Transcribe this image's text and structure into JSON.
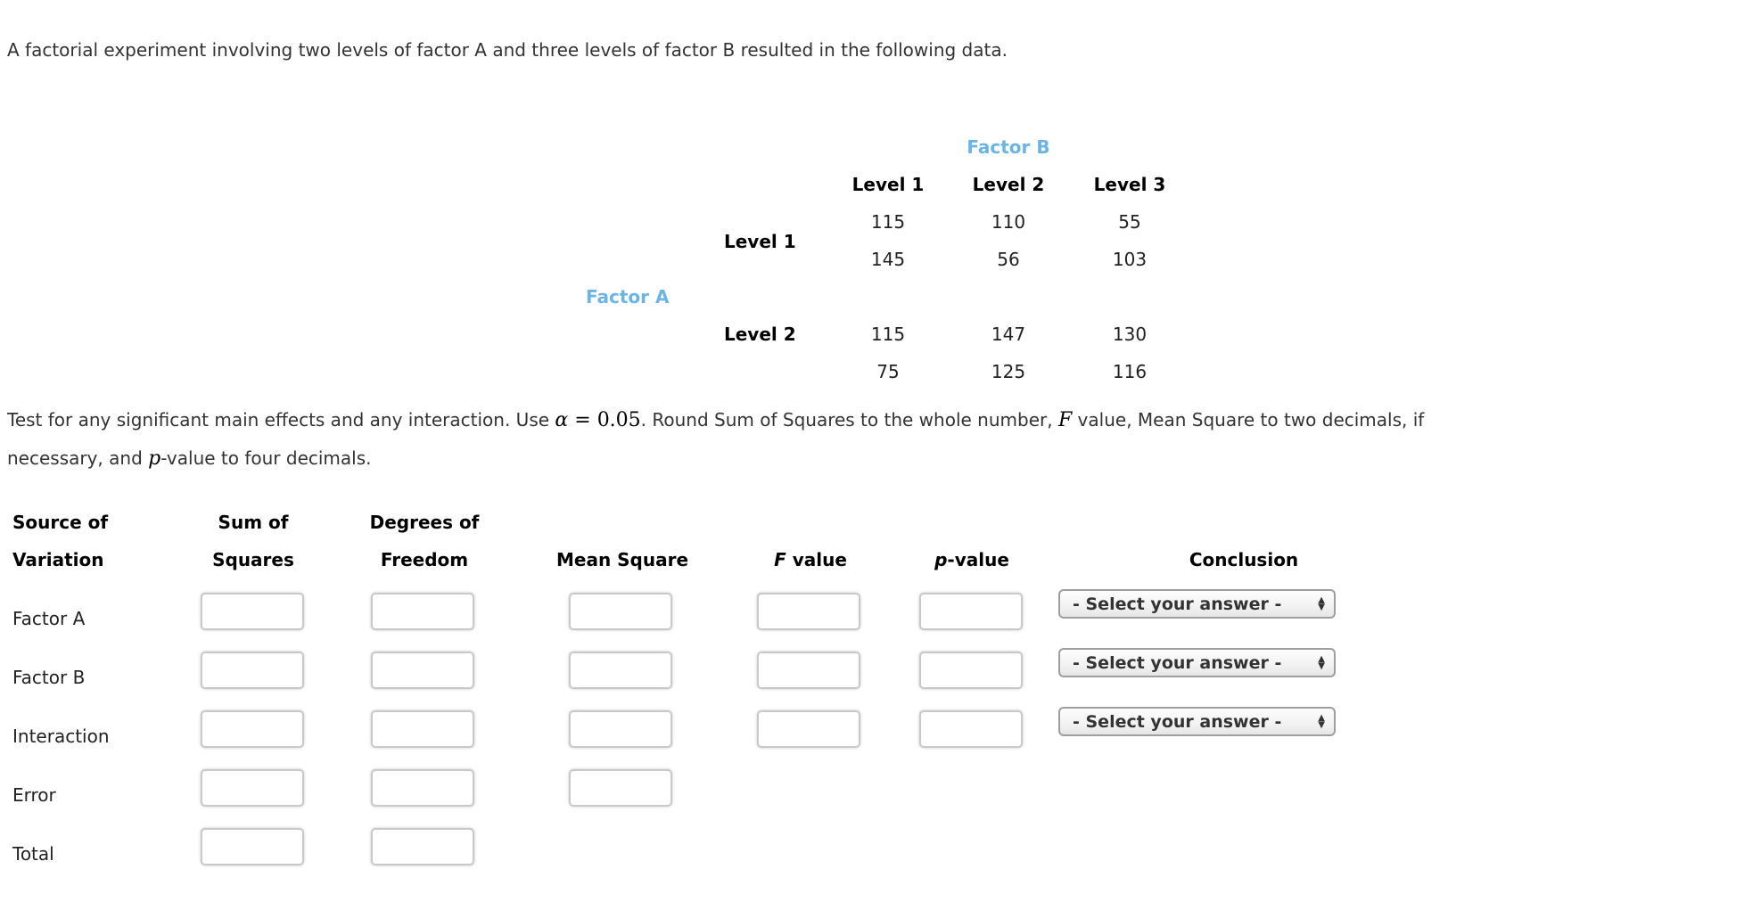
{
  "intro_text": "A factorial experiment involving two levels of factor A and three levels of factor B resulted in the following data.",
  "data_table": {
    "factor_b_label": "Factor B",
    "factor_a_label": "Factor A",
    "column_headers": [
      "Level 1",
      "Level 2",
      "Level 3"
    ],
    "row_labels": [
      "Level 1",
      "Level 2"
    ],
    "rows": [
      [
        "115",
        "110",
        "55"
      ],
      [
        "145",
        "56",
        "103"
      ],
      [
        "115",
        "147",
        "130"
      ],
      [
        "75",
        "125",
        "116"
      ]
    ]
  },
  "instructions": {
    "part1": "Test for any significant main effects and any interaction. Use ",
    "alpha_symbol": "α",
    "equals": " = ",
    "alpha_value": "0.05",
    "part2": ". Round Sum of Squares to the whole number, ",
    "f_symbol": "F",
    "part3": " value, Mean Square to two decimals, if",
    "part4": "necessary, and ",
    "p_symbol": "p",
    "part5": "-value to four decimals."
  },
  "anova_table": {
    "headers": {
      "source_line1": "Source of",
      "source_line2": "Variation",
      "ss_line1": "Sum of",
      "ss_line2": "Squares",
      "df_line1": "Degrees of",
      "df_line2": "Freedom",
      "ms": "Mean Square",
      "f_italic": "F",
      "f_rest": " value",
      "p_italic": "p",
      "p_rest": "-value",
      "conclusion": "Conclusion"
    },
    "rows": [
      {
        "label": "Factor A",
        "ss": "",
        "df": "",
        "ms": "",
        "f": "",
        "p": "",
        "conclusion": "- Select your answer -"
      },
      {
        "label": "Factor B",
        "ss": "",
        "df": "",
        "ms": "",
        "f": "",
        "p": "",
        "conclusion": "- Select your answer -"
      },
      {
        "label": "Interaction",
        "ss": "",
        "df": "",
        "ms": "",
        "f": "",
        "p": "",
        "conclusion": "- Select your answer -"
      },
      {
        "label": "Error",
        "ss": "",
        "df": "",
        "ms": ""
      },
      {
        "label": "Total",
        "ss": "",
        "df": ""
      }
    ]
  },
  "colors": {
    "factor_label": "#6cb4e4",
    "body_text": "#333333"
  }
}
